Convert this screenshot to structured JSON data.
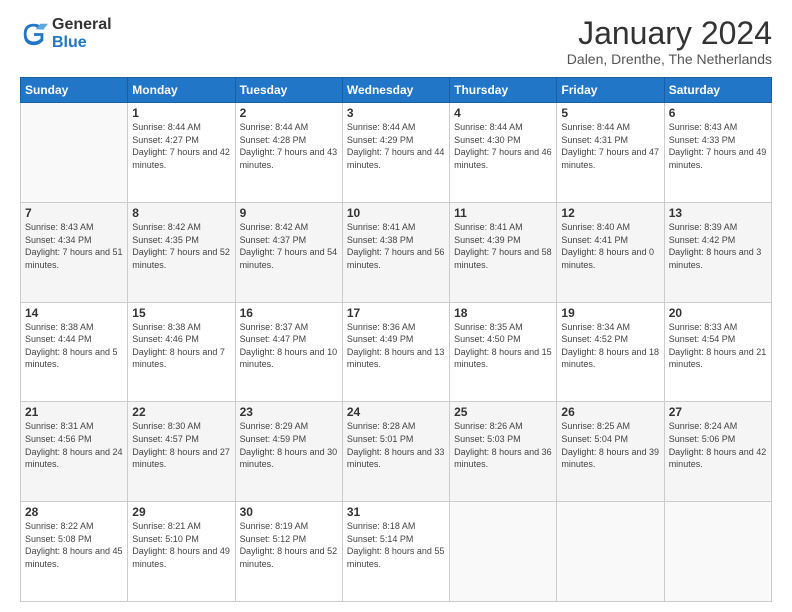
{
  "logo": {
    "general": "General",
    "blue": "Blue"
  },
  "header": {
    "month": "January 2024",
    "location": "Dalen, Drenthe, The Netherlands"
  },
  "weekdays": [
    "Sunday",
    "Monday",
    "Tuesday",
    "Wednesday",
    "Thursday",
    "Friday",
    "Saturday"
  ],
  "weeks": [
    [
      {
        "day": "",
        "sunrise": "",
        "sunset": "",
        "daylight": ""
      },
      {
        "day": "1",
        "sunrise": "Sunrise: 8:44 AM",
        "sunset": "Sunset: 4:27 PM",
        "daylight": "Daylight: 7 hours and 42 minutes."
      },
      {
        "day": "2",
        "sunrise": "Sunrise: 8:44 AM",
        "sunset": "Sunset: 4:28 PM",
        "daylight": "Daylight: 7 hours and 43 minutes."
      },
      {
        "day": "3",
        "sunrise": "Sunrise: 8:44 AM",
        "sunset": "Sunset: 4:29 PM",
        "daylight": "Daylight: 7 hours and 44 minutes."
      },
      {
        "day": "4",
        "sunrise": "Sunrise: 8:44 AM",
        "sunset": "Sunset: 4:30 PM",
        "daylight": "Daylight: 7 hours and 46 minutes."
      },
      {
        "day": "5",
        "sunrise": "Sunrise: 8:44 AM",
        "sunset": "Sunset: 4:31 PM",
        "daylight": "Daylight: 7 hours and 47 minutes."
      },
      {
        "day": "6",
        "sunrise": "Sunrise: 8:43 AM",
        "sunset": "Sunset: 4:33 PM",
        "daylight": "Daylight: 7 hours and 49 minutes."
      }
    ],
    [
      {
        "day": "7",
        "sunrise": "Sunrise: 8:43 AM",
        "sunset": "Sunset: 4:34 PM",
        "daylight": "Daylight: 7 hours and 51 minutes."
      },
      {
        "day": "8",
        "sunrise": "Sunrise: 8:42 AM",
        "sunset": "Sunset: 4:35 PM",
        "daylight": "Daylight: 7 hours and 52 minutes."
      },
      {
        "day": "9",
        "sunrise": "Sunrise: 8:42 AM",
        "sunset": "Sunset: 4:37 PM",
        "daylight": "Daylight: 7 hours and 54 minutes."
      },
      {
        "day": "10",
        "sunrise": "Sunrise: 8:41 AM",
        "sunset": "Sunset: 4:38 PM",
        "daylight": "Daylight: 7 hours and 56 minutes."
      },
      {
        "day": "11",
        "sunrise": "Sunrise: 8:41 AM",
        "sunset": "Sunset: 4:39 PM",
        "daylight": "Daylight: 7 hours and 58 minutes."
      },
      {
        "day": "12",
        "sunrise": "Sunrise: 8:40 AM",
        "sunset": "Sunset: 4:41 PM",
        "daylight": "Daylight: 8 hours and 0 minutes."
      },
      {
        "day": "13",
        "sunrise": "Sunrise: 8:39 AM",
        "sunset": "Sunset: 4:42 PM",
        "daylight": "Daylight: 8 hours and 3 minutes."
      }
    ],
    [
      {
        "day": "14",
        "sunrise": "Sunrise: 8:38 AM",
        "sunset": "Sunset: 4:44 PM",
        "daylight": "Daylight: 8 hours and 5 minutes."
      },
      {
        "day": "15",
        "sunrise": "Sunrise: 8:38 AM",
        "sunset": "Sunset: 4:46 PM",
        "daylight": "Daylight: 8 hours and 7 minutes."
      },
      {
        "day": "16",
        "sunrise": "Sunrise: 8:37 AM",
        "sunset": "Sunset: 4:47 PM",
        "daylight": "Daylight: 8 hours and 10 minutes."
      },
      {
        "day": "17",
        "sunrise": "Sunrise: 8:36 AM",
        "sunset": "Sunset: 4:49 PM",
        "daylight": "Daylight: 8 hours and 13 minutes."
      },
      {
        "day": "18",
        "sunrise": "Sunrise: 8:35 AM",
        "sunset": "Sunset: 4:50 PM",
        "daylight": "Daylight: 8 hours and 15 minutes."
      },
      {
        "day": "19",
        "sunrise": "Sunrise: 8:34 AM",
        "sunset": "Sunset: 4:52 PM",
        "daylight": "Daylight: 8 hours and 18 minutes."
      },
      {
        "day": "20",
        "sunrise": "Sunrise: 8:33 AM",
        "sunset": "Sunset: 4:54 PM",
        "daylight": "Daylight: 8 hours and 21 minutes."
      }
    ],
    [
      {
        "day": "21",
        "sunrise": "Sunrise: 8:31 AM",
        "sunset": "Sunset: 4:56 PM",
        "daylight": "Daylight: 8 hours and 24 minutes."
      },
      {
        "day": "22",
        "sunrise": "Sunrise: 8:30 AM",
        "sunset": "Sunset: 4:57 PM",
        "daylight": "Daylight: 8 hours and 27 minutes."
      },
      {
        "day": "23",
        "sunrise": "Sunrise: 8:29 AM",
        "sunset": "Sunset: 4:59 PM",
        "daylight": "Daylight: 8 hours and 30 minutes."
      },
      {
        "day": "24",
        "sunrise": "Sunrise: 8:28 AM",
        "sunset": "Sunset: 5:01 PM",
        "daylight": "Daylight: 8 hours and 33 minutes."
      },
      {
        "day": "25",
        "sunrise": "Sunrise: 8:26 AM",
        "sunset": "Sunset: 5:03 PM",
        "daylight": "Daylight: 8 hours and 36 minutes."
      },
      {
        "day": "26",
        "sunrise": "Sunrise: 8:25 AM",
        "sunset": "Sunset: 5:04 PM",
        "daylight": "Daylight: 8 hours and 39 minutes."
      },
      {
        "day": "27",
        "sunrise": "Sunrise: 8:24 AM",
        "sunset": "Sunset: 5:06 PM",
        "daylight": "Daylight: 8 hours and 42 minutes."
      }
    ],
    [
      {
        "day": "28",
        "sunrise": "Sunrise: 8:22 AM",
        "sunset": "Sunset: 5:08 PM",
        "daylight": "Daylight: 8 hours and 45 minutes."
      },
      {
        "day": "29",
        "sunrise": "Sunrise: 8:21 AM",
        "sunset": "Sunset: 5:10 PM",
        "daylight": "Daylight: 8 hours and 49 minutes."
      },
      {
        "day": "30",
        "sunrise": "Sunrise: 8:19 AM",
        "sunset": "Sunset: 5:12 PM",
        "daylight": "Daylight: 8 hours and 52 minutes."
      },
      {
        "day": "31",
        "sunrise": "Sunrise: 8:18 AM",
        "sunset": "Sunset: 5:14 PM",
        "daylight": "Daylight: 8 hours and 55 minutes."
      },
      {
        "day": "",
        "sunrise": "",
        "sunset": "",
        "daylight": ""
      },
      {
        "day": "",
        "sunrise": "",
        "sunset": "",
        "daylight": ""
      },
      {
        "day": "",
        "sunrise": "",
        "sunset": "",
        "daylight": ""
      }
    ]
  ]
}
